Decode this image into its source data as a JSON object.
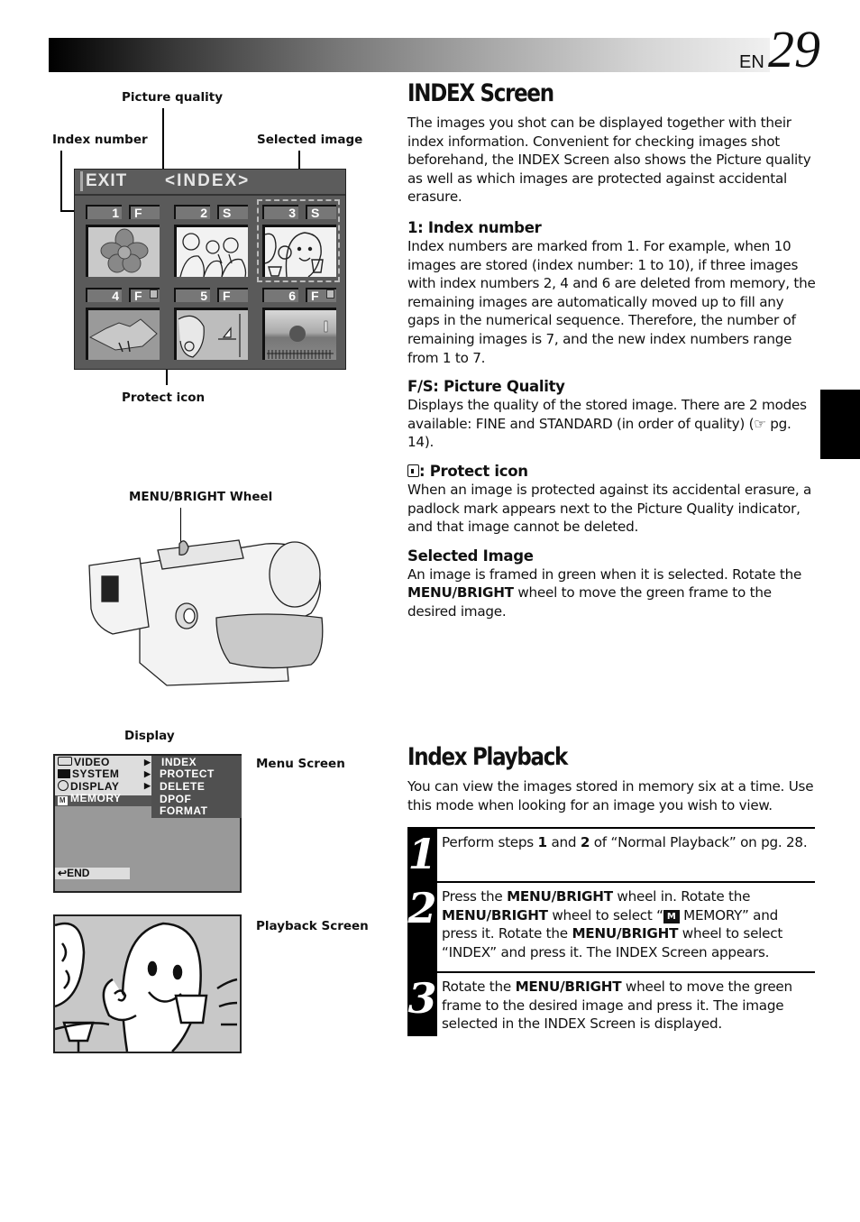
{
  "header": {
    "language": "EN",
    "page_number": "29"
  },
  "diagram_index": {
    "callouts": {
      "picture_quality": "Picture quality",
      "index_number": "Index number",
      "selected_image": "Selected image",
      "protect_icon": "Protect icon"
    },
    "screen": {
      "exit_label": "EXIT",
      "title": "<INDEX>",
      "cells": [
        {
          "index": "1",
          "quality": "F",
          "protected": false,
          "selected": false,
          "subject": "flower"
        },
        {
          "index": "2",
          "quality": "S",
          "protected": false,
          "selected": false,
          "subject": "group toasting"
        },
        {
          "index": "3",
          "quality": "S",
          "protected": false,
          "selected": true,
          "subject": "woman with glass"
        },
        {
          "index": "4",
          "quality": "F",
          "protected": true,
          "selected": false,
          "subject": "mountain"
        },
        {
          "index": "5",
          "quality": "F",
          "protected": false,
          "selected": false,
          "subject": "woman at sea with sailboat"
        },
        {
          "index": "6",
          "quality": "F",
          "protected": true,
          "selected": false,
          "subject": "sunset with lighthouse"
        }
      ]
    }
  },
  "diagram_camera": {
    "callout": "MENU/BRIGHT Wheel"
  },
  "diagram_display": {
    "heading": "Display",
    "menu_screen_label": "Menu Screen",
    "playback_screen_label": "Playback Screen",
    "menu": {
      "left_items": [
        {
          "icon": "tape-icon",
          "label": "VIDEO",
          "has_submenu": true
        },
        {
          "icon": "camera-icon",
          "label": "SYSTEM",
          "has_submenu": true
        },
        {
          "icon": "clock-icon",
          "label": "DISPLAY",
          "has_submenu": true
        },
        {
          "icon": "memory-icon",
          "label": "MEMORY",
          "has_submenu": false,
          "selected": true
        }
      ],
      "sub_items": [
        "INDEX",
        "PROTECT",
        "DELETE",
        "DPOF",
        "FORMAT"
      ],
      "end_label": "END"
    }
  },
  "index_screen_section": {
    "title": "INDEX Screen",
    "intro": "The images you shot can be displayed together with their index information. Convenient for checking images shot beforehand, the INDEX Screen also shows the Picture quality as well as which images are protected against accidental erasure.",
    "index_number": {
      "heading": "1: Index number",
      "body": "Index numbers are marked from 1. For example, when 10 images are stored (index number: 1 to 10), if three images with index numbers 2, 4 and 6 are deleted from memory, the remaining images are automatically moved up to fill any gaps in the numerical sequence. Therefore, the number of remaining images is 7, and the new index numbers range from 1 to 7."
    },
    "picture_quality": {
      "heading": "F/S: Picture Quality",
      "body_before": "Displays the quality of the stored image. There are 2 modes available: FINE and STANDARD (in order of quality) (",
      "ref_glyph": "☞",
      "body_after": " pg. 14)."
    },
    "protect_icon": {
      "heading": ": Protect icon",
      "body": "When an image is protected against its accidental erasure, a padlock mark appears next to the Picture Quality indicator, and that image cannot be deleted."
    },
    "selected_image": {
      "heading": "Selected Image",
      "body_before": "An image is framed in green when it is selected. Rotate the ",
      "bold": "MENU/BRIGHT",
      "body_after": " wheel to move the green frame to the desired image."
    }
  },
  "index_playback_section": {
    "title": "Index Playback",
    "intro": "You can view the images stored in memory six at a time. Use this mode when looking for an image you wish to view.",
    "steps": [
      {
        "number": "1",
        "parts": [
          "Perform steps ",
          "1",
          " and ",
          "2",
          " of “Normal Playback” on pg. 28."
        ]
      },
      {
        "number": "2",
        "parts": [
          "Press the ",
          "MENU/BRIGHT",
          " wheel in. Rotate the ",
          "MENU/BRIGHT",
          " wheel to select “",
          "M",
          " MEMORY” and press it. Rotate the ",
          "MENU/BRIGHT",
          " wheel to select “INDEX” and press it. The INDEX Screen appears."
        ]
      },
      {
        "number": "3",
        "parts": [
          "Rotate the ",
          "MENU/BRIGHT",
          " wheel to move the green frame to the desired image and press it. The image selected in the INDEX Screen is displayed."
        ]
      }
    ]
  }
}
